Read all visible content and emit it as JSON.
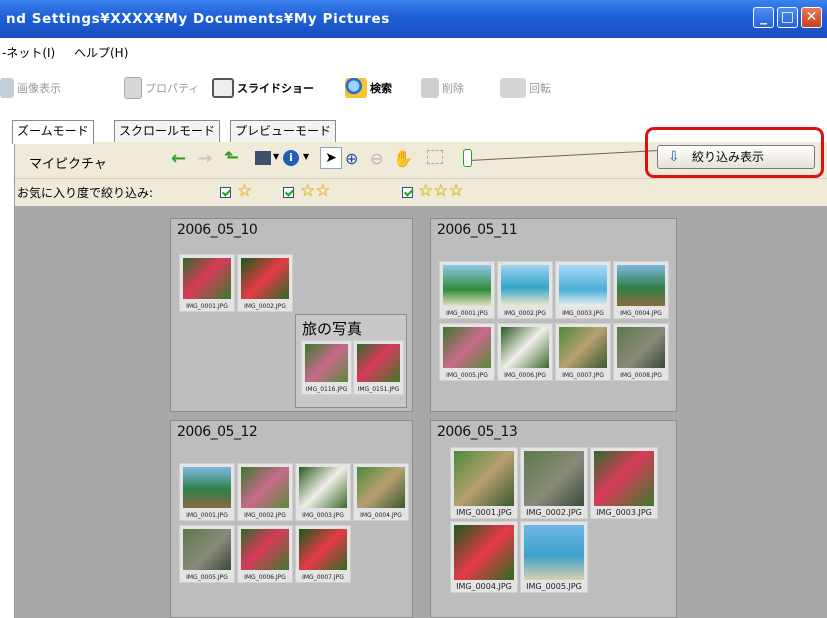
{
  "window": {
    "title": "nd Settings¥XXXX¥My Documents¥My Pictures",
    "controls": {
      "minimize": "_",
      "maximize": "□",
      "close": "✕"
    }
  },
  "menu": {
    "items": [
      "-ネット(I)",
      "ヘルプ(H)"
    ]
  },
  "toolbar": {
    "view_image": "画像表示",
    "properties": "プロパティ",
    "slideshow": "スライドショー",
    "search": "検索",
    "delete": "削除",
    "rotate": "回転"
  },
  "tabs": [
    "ズームモード",
    "スクロールモード",
    "プレビューモード"
  ],
  "panel": {
    "location": "マイピクチャ",
    "filter_button": "絞り込み表示",
    "rating_filter_label": "お気に入り度で絞り込み:",
    "rating_filters": [
      {
        "checked": true,
        "stars": "☆"
      },
      {
        "checked": true,
        "stars": "☆☆"
      },
      {
        "checked": true,
        "stars": "☆☆☆"
      }
    ]
  },
  "groups": [
    {
      "date": "2006_05_10",
      "photos": [
        "IMG_0001.JPG",
        "IMG_0002.JPG"
      ],
      "subgroup": {
        "title": "旅の写真",
        "photos": [
          "IMG_0116.JPG",
          "IMG_0151.JPG"
        ]
      }
    },
    {
      "date": "2006_05_11",
      "photos": [
        "IMG_0001.JPG",
        "IMG_0002.JPG",
        "IMG_0003.JPG",
        "IMG_0004.JPG",
        "IMG_0005.JPG",
        "IMG_0006.JPG",
        "IMG_0007.JPG",
        "IMG_0008.JPG"
      ]
    },
    {
      "date": "2006_05_12",
      "photos": [
        "IMG_0001.JPG",
        "IMG_0002.JPG",
        "IMG_0003.JPG",
        "IMG_0004.JPG",
        "IMG_0005.JPG",
        "IMG_0006.JPG",
        "IMG_0007.JPG"
      ]
    },
    {
      "date": "2006_05_13",
      "photos": [
        "IMG_0001.JPG",
        "IMG_0002.JPG",
        "IMG_0003.JPG",
        "IMG_0004.JPG",
        "IMG_0005.JPG"
      ]
    }
  ],
  "colors": {
    "title_bar": "#1f5fd6",
    "panel_bg": "#f0ead8",
    "content_bg": "#a8a8a8",
    "highlight": "#e01010"
  }
}
